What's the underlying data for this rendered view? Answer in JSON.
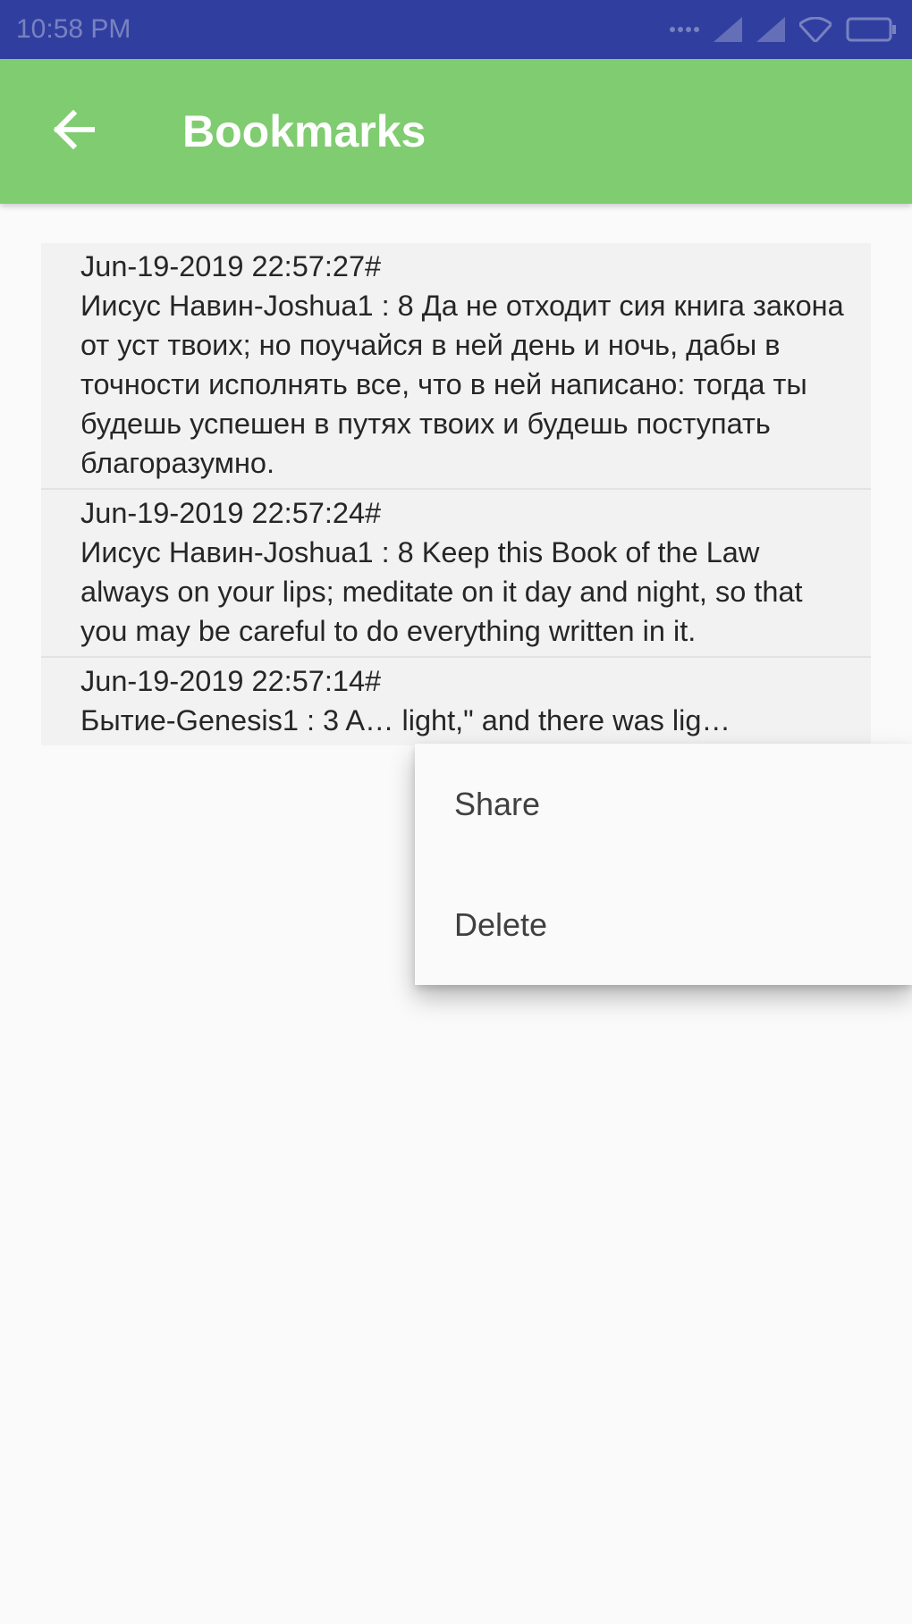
{
  "status_bar": {
    "time": "10:58 PM",
    "icons": [
      "more-dots-icon",
      "signal-icon",
      "signal-icon",
      "wifi-icon",
      "battery-icon"
    ]
  },
  "app_bar": {
    "title": "Bookmarks",
    "back_icon": "arrow-back-icon",
    "background": "#80cc70"
  },
  "bookmarks": [
    {
      "date": "Jun-19-2019 22:57:27#",
      "text": "Иисус Навин-Joshua1 : 8  Да не отходит сия книга закона от уст твоих; но поучайся в ней день и ночь, дабы в точности исполнять все, что в ней написано: тогда ты будешь успешен в путях твоих и будешь поступать благоразумно."
    },
    {
      "date": "Jun-19-2019 22:57:24#",
      "text": "Иисус Навин-Joshua1 :  8 Keep this Book of the Law always on your lips; meditate on it day and night, so that you may be careful to do everything written in it."
    },
    {
      "date": "Jun-19-2019 22:57:14#",
      "text": "Бытие-Genesis1 :  3 A… light,\" and there was lig…"
    }
  ],
  "context_menu": {
    "items": [
      "Share",
      "Delete"
    ]
  },
  "colors": {
    "status_bar": "#303f9f",
    "app_bar": "#80cc70",
    "list_bg": "#f2f2f2",
    "page_bg": "#fafafa"
  }
}
